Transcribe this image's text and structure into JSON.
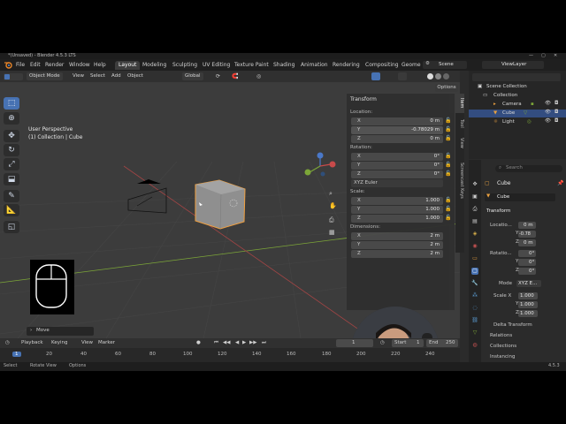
{
  "window": {
    "title": "*(Unsaved) - Blender 4.5.3 LTS",
    "controls": [
      "—",
      "▢",
      "✕"
    ]
  },
  "menus": [
    "File",
    "Edit",
    "Render",
    "Window",
    "Help"
  ],
  "workspaces": [
    "Layout",
    "Modeling",
    "Sculpting",
    "UV Editing",
    "Texture Paint",
    "Shading",
    "Animation",
    "Rendering",
    "Compositing",
    "Geome"
  ],
  "active_workspace": "Layout",
  "scene": {
    "label": "Scene",
    "view_layer": "ViewLayer"
  },
  "viewport_header": {
    "mode": "Object Mode",
    "menus": [
      "View",
      "Select",
      "Add",
      "Object"
    ],
    "transform_orientation": "Global",
    "options": "Options"
  },
  "viewport": {
    "view_name": "User Perspective",
    "collection": "(1) Collection | Cube"
  },
  "npanel": {
    "header": "Transform",
    "location_label": "Location:",
    "location": [
      {
        "axis": "X",
        "value": "0 m"
      },
      {
        "axis": "Y",
        "value": "-0.78029 m"
      },
      {
        "axis": "Z",
        "value": "0 m"
      }
    ],
    "rotation_label": "Rotation:",
    "rotation": [
      {
        "axis": "X",
        "value": "0°"
      },
      {
        "axis": "Y",
        "value": "0°"
      },
      {
        "axis": "Z",
        "value": "0°"
      }
    ],
    "rotation_mode": "XYZ Euler",
    "scale_label": "Scale:",
    "scale": [
      {
        "axis": "X",
        "value": "1.000"
      },
      {
        "axis": "Y",
        "value": "1.000"
      },
      {
        "axis": "Z",
        "value": "1.000"
      }
    ],
    "dimensions_label": "Dimensions:",
    "dimensions": [
      {
        "axis": "X",
        "value": "2 m"
      },
      {
        "axis": "Y",
        "value": "2 m"
      },
      {
        "axis": "Z",
        "value": "2 m"
      }
    ]
  },
  "side_tabs": [
    "Item",
    "Tool",
    "View",
    "Screencast Keys"
  ],
  "outliner": {
    "scene_collection": "Scene Collection",
    "items": [
      {
        "name": "Collection",
        "icon": "collection-icon"
      },
      {
        "name": "Camera",
        "icon": "camera-icon"
      },
      {
        "name": "Cube",
        "icon": "mesh-icon"
      },
      {
        "name": "Light",
        "icon": "light-icon"
      }
    ]
  },
  "properties": {
    "search_placeholder": "Search",
    "object_name": "Cube",
    "data_name": "Cube",
    "transform_header": "Transform",
    "location_label": "Locatio...",
    "location": [
      {
        "axis": "X",
        "value": "0 m"
      },
      {
        "axis": "Y",
        "value": "-0.78"
      },
      {
        "axis": "Z",
        "value": "0 m"
      }
    ],
    "rotation_label": "Rotatio...",
    "rotation": [
      {
        "axis": "X",
        "value": "0°"
      },
      {
        "axis": "Y",
        "value": "0°"
      },
      {
        "axis": "Z",
        "value": "0°"
      }
    ],
    "mode_label": "Mode",
    "mode_value": "XYZ E...",
    "scale_label": "Scale X",
    "scale": [
      {
        "axis": "X",
        "value": "1.000"
      },
      {
        "axis": "Y",
        "value": "1.000"
      },
      {
        "axis": "Z",
        "value": "1.000"
      }
    ],
    "sections": [
      "Delta Transform",
      "Relations",
      "Collections",
      "Instancing"
    ]
  },
  "timeline": {
    "menus": [
      "Playback",
      "Keying",
      "View",
      "Marker"
    ],
    "current_frame": "1",
    "start_label": "Start",
    "start": "1",
    "end_label": "End",
    "end": "250",
    "ticks": [
      "1",
      "20",
      "40",
      "60",
      "80",
      "100",
      "120",
      "140",
      "160",
      "180",
      "200",
      "220",
      "240"
    ]
  },
  "status_bar": {
    "items": [
      "Select",
      "Rotate View",
      "Options"
    ],
    "version": "4.5.3"
  },
  "overlay": {
    "move_label": "Move"
  },
  "colors": {
    "accent": "#4772b3",
    "selection_outline": "#f0a040",
    "x_axis": "#c84a4a",
    "y_axis": "#7ca638",
    "z_axis": "#4a78c8"
  }
}
